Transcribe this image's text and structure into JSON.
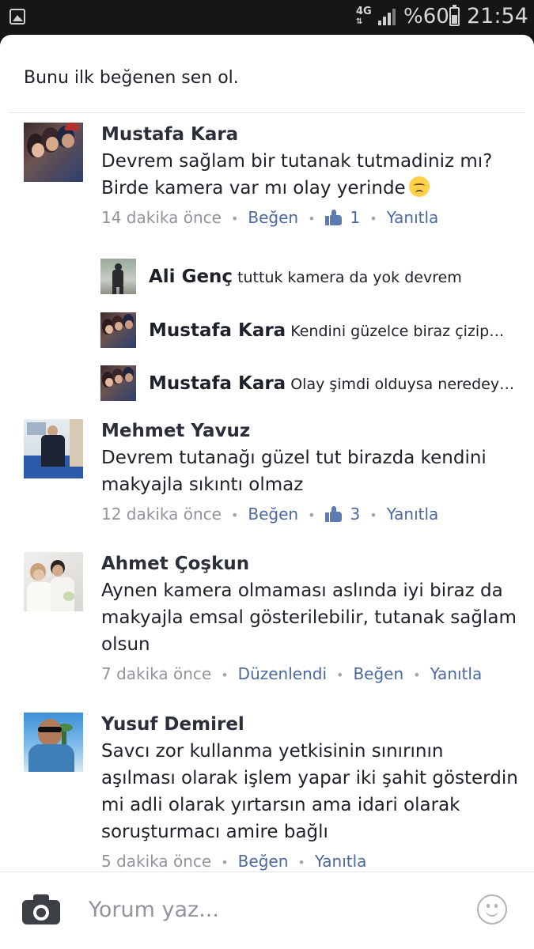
{
  "status_bar": {
    "network": "4G",
    "battery_percent": "%60",
    "time": "21:54"
  },
  "likes_text": "Bunu ilk beğenen sen ol.",
  "comments": [
    {
      "name": "Mustafa Kara",
      "text": "Devrem sağlam bir tutanak tutmadiniz mı? Birde kamera var mı olay yerinde",
      "emoji": "disappointed-face",
      "time": "14 dakika önce",
      "like_label": "Beğen",
      "like_count": "1",
      "reply_label": "Yanıtla",
      "replies": [
        {
          "name": "Ali Genç",
          "text": "tuttuk kamera da yok devrem"
        },
        {
          "name": "Mustafa Kara",
          "text": "Kendini güzelce biraz çizip…"
        },
        {
          "name": "Mustafa Kara",
          "text": "Olay şimdi olduysa neredey…"
        }
      ]
    },
    {
      "name": "Mehmet Yavuz",
      "text": "Devrem tutanağı güzel tut birazda kendini makyajla sıkıntı olmaz",
      "time": "12 dakika önce",
      "like_label": "Beğen",
      "like_count": "3",
      "reply_label": "Yanıtla"
    },
    {
      "name": "Ahmet Çoşkun",
      "text": "Aynen kamera olmaması aslında iyi biraz da makyajla  emsal gösterilebilir,  tutanak sağlam olsun",
      "time": "7 dakika önce",
      "edited_label": "Düzenlendi",
      "like_label": "Beğen",
      "reply_label": "Yanıtla"
    },
    {
      "name": "Yusuf Demirel",
      "text": "Savcı zor kullanma yetkisinin sınırının aşılması olarak işlem yapar iki şahit gösterdin mi adli olarak yırtarsın ama idari olarak soruşturmacı amire bağlı",
      "time": "5 dakika önce",
      "like_label": "Beğen",
      "reply_label": "Yanıtla"
    }
  ],
  "composer": {
    "placeholder": "Yorum yaz..."
  },
  "colors": {
    "link": "#4b68a1",
    "meta": "#90949c",
    "text": "#1d2129"
  }
}
